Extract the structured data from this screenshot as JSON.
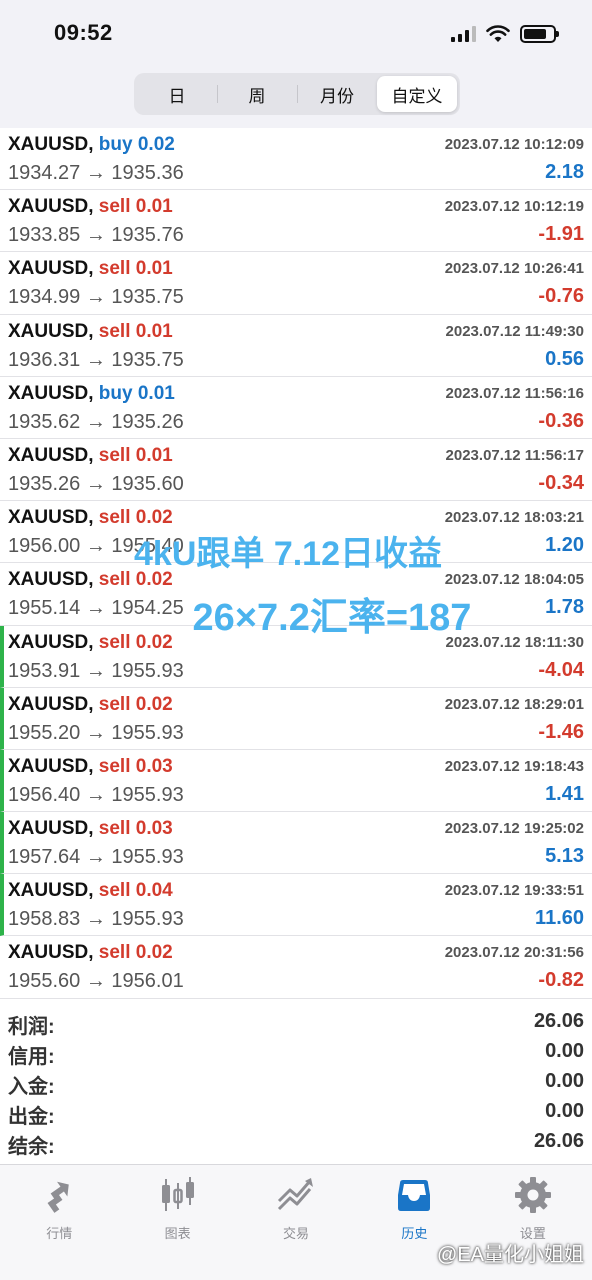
{
  "status_bar": {
    "time": "09:52"
  },
  "period_tabs": [
    {
      "label": "日"
    },
    {
      "label": "周"
    },
    {
      "label": "月份"
    },
    {
      "label": "自定义",
      "selected": true
    }
  ],
  "trades": [
    {
      "symbol": "XAUUSD,",
      "side": "buy 0.02",
      "datetime": "2023.07.12 10:12:09",
      "prices": "1934.27 → 1935.36",
      "profit": "2.18"
    },
    {
      "symbol": "XAUUSD,",
      "side": "sell 0.01",
      "datetime": "2023.07.12 10:12:19",
      "prices": "1933.85 → 1935.76",
      "profit": "-1.91"
    },
    {
      "symbol": "XAUUSD,",
      "side": "sell 0.01",
      "datetime": "2023.07.12 10:26:41",
      "prices": "1934.99 → 1935.75",
      "profit": "-0.76"
    },
    {
      "symbol": "XAUUSD,",
      "side": "sell 0.01",
      "datetime": "2023.07.12 11:49:30",
      "prices": "1936.31 → 1935.75",
      "profit": "0.56"
    },
    {
      "symbol": "XAUUSD,",
      "side": "buy 0.01",
      "datetime": "2023.07.12 11:56:16",
      "prices": "1935.62 → 1935.26",
      "profit": "-0.36"
    },
    {
      "symbol": "XAUUSD,",
      "side": "sell 0.01",
      "datetime": "2023.07.12 11:56:17",
      "prices": "1935.26 → 1935.60",
      "profit": "-0.34"
    },
    {
      "symbol": "XAUUSD,",
      "side": "sell 0.02",
      "datetime": "2023.07.12 18:03:21",
      "prices": "1956.00 → 1955.40",
      "profit": "1.20"
    },
    {
      "symbol": "XAUUSD,",
      "side": "sell 0.02",
      "datetime": "2023.07.12 18:04:05",
      "prices": "1955.14 → 1954.25",
      "profit": "1.78"
    },
    {
      "symbol": "XAUUSD,",
      "side": "sell 0.02",
      "datetime": "2023.07.12 18:11:30",
      "prices": "1953.91 → 1955.93",
      "profit": "-4.04",
      "marked": true
    },
    {
      "symbol": "XAUUSD,",
      "side": "sell 0.02",
      "datetime": "2023.07.12 18:29:01",
      "prices": "1955.20 → 1955.93",
      "profit": "-1.46",
      "marked": true
    },
    {
      "symbol": "XAUUSD,",
      "side": "sell 0.03",
      "datetime": "2023.07.12 19:18:43",
      "prices": "1956.40 → 1955.93",
      "profit": "1.41",
      "marked": true
    },
    {
      "symbol": "XAUUSD,",
      "side": "sell 0.03",
      "datetime": "2023.07.12 19:25:02",
      "prices": "1957.64 → 1955.93",
      "profit": "5.13",
      "marked": true
    },
    {
      "symbol": "XAUUSD,",
      "side": "sell 0.04",
      "datetime": "2023.07.12 19:33:51",
      "prices": "1958.83 → 1955.93",
      "profit": "11.60",
      "marked": true
    },
    {
      "symbol": "XAUUSD,",
      "side": "sell 0.02",
      "datetime": "2023.07.12 20:31:56",
      "prices": "1955.60 → 1956.01",
      "profit": "-0.82"
    }
  ],
  "summary": [
    {
      "label": "利润:",
      "value": "26.06"
    },
    {
      "label": "信用:",
      "value": "0.00"
    },
    {
      "label": "入金:",
      "value": "0.00"
    },
    {
      "label": "出金:",
      "value": "0.00"
    },
    {
      "label": "结余:",
      "value": "26.06"
    }
  ],
  "overlay": {
    "line1": "4kU跟单 7.12日收益",
    "line2": "26×7.2汇率=187"
  },
  "tab_bar": [
    {
      "label": "行情",
      "icon": "quotes-icon"
    },
    {
      "label": "图表",
      "icon": "chart-candles-icon"
    },
    {
      "label": "交易",
      "icon": "trade-icon"
    },
    {
      "label": "历史",
      "icon": "history-inbox-icon",
      "active": true
    },
    {
      "label": "设置",
      "icon": "gear-icon"
    }
  ],
  "watermark": "@EA量化小姐姐",
  "colors": {
    "buy": "#1a75c7",
    "sell": "#d33b2d",
    "positive": "#1a75c7",
    "negative": "#d33b2d",
    "marker": "#2eb34a",
    "overlay": "#4bb3ee"
  }
}
